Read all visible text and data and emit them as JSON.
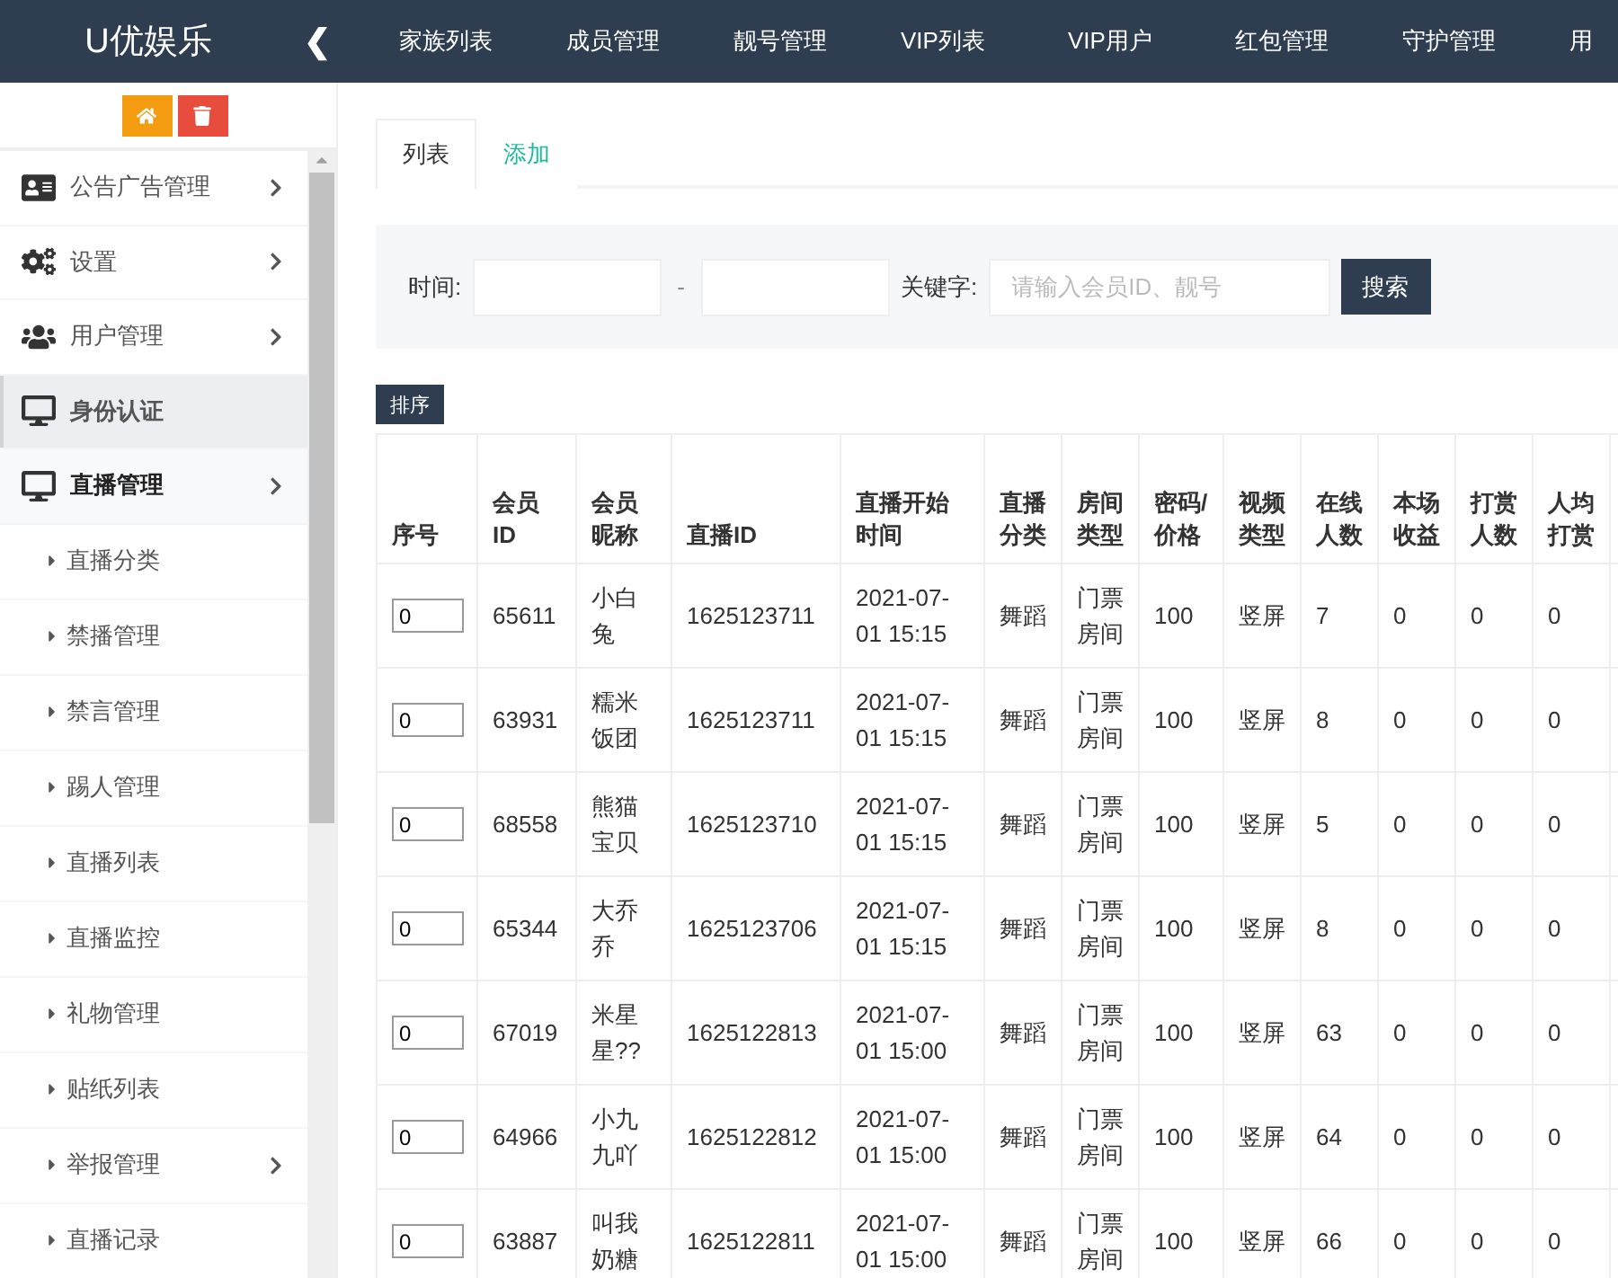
{
  "header": {
    "logo": "U优娱乐",
    "collapse_glyph": "❮",
    "nav": [
      {
        "label": "家族列表"
      },
      {
        "label": "成员管理"
      },
      {
        "label": "靓号管理"
      },
      {
        "label": "VIP列表"
      },
      {
        "label": "VIP用户"
      },
      {
        "label": "红包管理"
      },
      {
        "label": "守护管理"
      },
      {
        "label": "用"
      }
    ]
  },
  "sidebar": {
    "items": [
      {
        "label": "公告广告管理",
        "submenu": true,
        "selected": false,
        "expanded": false
      },
      {
        "label": "设置",
        "submenu": true,
        "selected": false,
        "expanded": false
      },
      {
        "label": "用户管理",
        "submenu": true,
        "selected": false,
        "expanded": false
      },
      {
        "label": "身份认证",
        "submenu": false,
        "selected": true,
        "expanded": false
      },
      {
        "label": "直播管理",
        "submenu": true,
        "selected": false,
        "expanded": true,
        "children": [
          {
            "label": "直播分类",
            "submenu": false
          },
          {
            "label": "禁播管理",
            "submenu": false
          },
          {
            "label": "禁言管理",
            "submenu": false
          },
          {
            "label": "踢人管理",
            "submenu": false
          },
          {
            "label": "直播列表",
            "submenu": false
          },
          {
            "label": "直播监控",
            "submenu": false
          },
          {
            "label": "礼物管理",
            "submenu": false
          },
          {
            "label": "贴纸列表",
            "submenu": false
          },
          {
            "label": "举报管理",
            "submenu": true
          },
          {
            "label": "直播记录",
            "submenu": false
          }
        ]
      }
    ]
  },
  "tabs": [
    {
      "label": "列表",
      "selected": true
    },
    {
      "label": "添加",
      "selected": false
    }
  ],
  "filter": {
    "time_label": "时间:",
    "separator": "-",
    "keyword_label": "关键字:",
    "keyword_placeholder": "请输入会员ID、靓号",
    "search_button": "搜索"
  },
  "sort_button": "排序",
  "table": {
    "columns": [
      "序号",
      "会员ID",
      "会员昵称",
      "直播ID",
      "直播开始时间",
      "直播分类",
      "房间类型",
      "密码/价格",
      "视频类型",
      "在线人数",
      "本场收益",
      "打赏人数",
      "人均打赏"
    ],
    "rows": [
      {
        "cells": [
          "0",
          "65611",
          "小白兔",
          "1625123711",
          "2021-07-01 15:15",
          "舞蹈",
          "门票房间",
          "100",
          "竖屏",
          "7",
          "0",
          "0",
          "0"
        ]
      },
      {
        "cells": [
          "0",
          "63931",
          "糯米饭团",
          "1625123711",
          "2021-07-01 15:15",
          "舞蹈",
          "门票房间",
          "100",
          "竖屏",
          "8",
          "0",
          "0",
          "0"
        ]
      },
      {
        "cells": [
          "0",
          "68558",
          "熊猫宝贝",
          "1625123710",
          "2021-07-01 15:15",
          "舞蹈",
          "门票房间",
          "100",
          "竖屏",
          "5",
          "0",
          "0",
          "0"
        ]
      },
      {
        "cells": [
          "0",
          "65344",
          "大乔乔",
          "1625123706",
          "2021-07-01 15:15",
          "舞蹈",
          "门票房间",
          "100",
          "竖屏",
          "8",
          "0",
          "0",
          "0"
        ]
      },
      {
        "cells": [
          "0",
          "67019",
          "米星星??",
          "1625122813",
          "2021-07-01 15:00",
          "舞蹈",
          "门票房间",
          "100",
          "竖屏",
          "63",
          "0",
          "0",
          "0"
        ]
      },
      {
        "cells": [
          "0",
          "64966",
          "小九九吖",
          "1625122812",
          "2021-07-01 15:00",
          "舞蹈",
          "门票房间",
          "100",
          "竖屏",
          "64",
          "0",
          "0",
          "0"
        ]
      },
      {
        "cells": [
          "0",
          "63887",
          "叫我奶糖",
          "1625122811",
          "2021-07-01 15:00",
          "舞蹈",
          "门票房间",
          "100",
          "竖屏",
          "66",
          "0",
          "0",
          "0"
        ]
      }
    ]
  }
}
